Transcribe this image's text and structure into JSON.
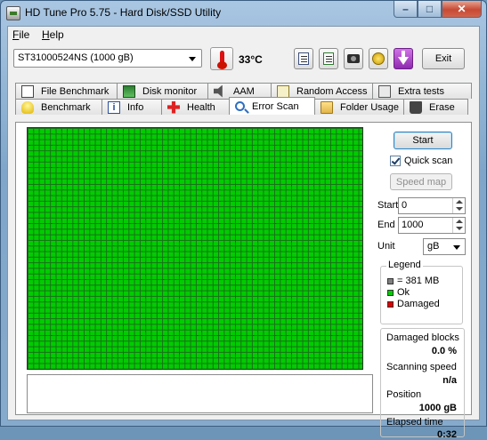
{
  "window": {
    "title": "HD Tune Pro 5.75 - Hard Disk/SSD Utility"
  },
  "menu": {
    "file_prefix": "F",
    "file_rest": "ile",
    "help_prefix": "H",
    "help_rest": "elp"
  },
  "toolbar": {
    "drive": "ST31000524NS (1000 gB)",
    "temperature": "33°C",
    "exit_label": "Exit"
  },
  "tabs_top": [
    {
      "label": "File Benchmark",
      "icon": "document-benchmark-icon"
    },
    {
      "label": "Disk monitor",
      "icon": "disk-monitor-icon"
    },
    {
      "label": "AAM",
      "icon": "speaker-icon"
    },
    {
      "label": "Random Access",
      "icon": "random-access-icon"
    },
    {
      "label": "Extra tests",
      "icon": "extra-tests-icon"
    }
  ],
  "tabs_bottom": [
    {
      "label": "Benchmark",
      "icon": "lightbulb-icon"
    },
    {
      "label": "Info",
      "icon": "info-icon"
    },
    {
      "label": "Health",
      "icon": "health-cross-icon"
    },
    {
      "label": "Error Scan",
      "icon": "magnifier-icon",
      "active": true
    },
    {
      "label": "Folder Usage",
      "icon": "folder-icon"
    },
    {
      "label": "Erase",
      "icon": "trash-icon"
    }
  ],
  "scan": {
    "start_button": "Start",
    "quick_scan_label": "Quick scan",
    "quick_scan_checked": true,
    "speed_map_button": "Speed map",
    "start_label": "Start",
    "start_value": "0",
    "end_label": "End",
    "end_value": "1000",
    "unit_label": "Unit",
    "unit_value": "gB",
    "block_state": "ok"
  },
  "legend": {
    "title": "Legend",
    "items": [
      {
        "label": "= 381 MB",
        "color": "#808080"
      },
      {
        "label": "Ok",
        "color": "#00cc00"
      },
      {
        "label": "Damaged",
        "color": "#e00000"
      }
    ]
  },
  "stats": {
    "damaged_blocks_label": "Damaged blocks",
    "damaged_blocks_value": "0.0 %",
    "scanning_speed_label": "Scanning speed",
    "scanning_speed_value": "n/a",
    "position_label": "Position",
    "position_value": "1000 gB",
    "elapsed_label": "Elapsed time",
    "elapsed_value": "0:32"
  },
  "colors": {
    "ok_block": "#00cc00",
    "grid_line": "#1a6e1a",
    "window_frame": "#7fa6c9",
    "close_button": "#c74a34"
  }
}
